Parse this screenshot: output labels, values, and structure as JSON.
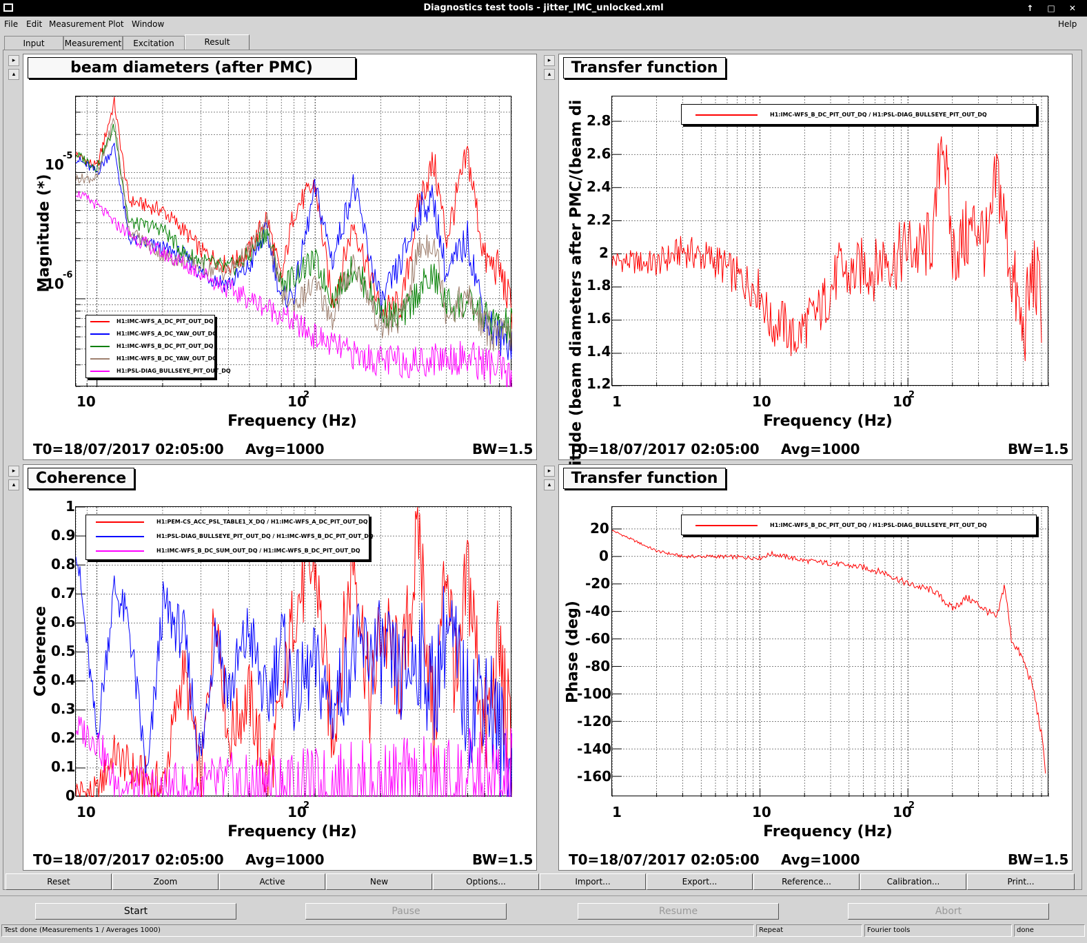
{
  "window": {
    "title": "Diagnostics test tools - jitter_IMC_unlocked.xml",
    "controls": "↑ □ ✕"
  },
  "menu": {
    "file": "File",
    "edit": "Edit",
    "measurement": "Measurement",
    "plot": "Plot",
    "window": "Window",
    "help": "Help"
  },
  "tabs": {
    "input": "Input",
    "measurement": "Measurement",
    "excitation": "Excitation",
    "result": "Result"
  },
  "panels": {
    "tl": {
      "title": "beam diameters (after PMC)",
      "ylabel": "Magnitude (*)",
      "xlabel": "Frequency (Hz)",
      "yticks": [
        "10",
        "-5",
        "10",
        "-6"
      ],
      "xticks": [
        "10",
        "10",
        "2"
      ],
      "footer": {
        "t0": "T0=18/07/2017 02:05:00",
        "avg": "Avg=1000",
        "bw": "BW=1.5"
      },
      "legend": [
        "H1:IMC-WFS_A_DC_PIT_OUT_DQ",
        "H1:IMC-WFS_A_DC_YAW_OUT_DQ",
        "H1:IMC-WFS_B_DC_PIT_OUT_DQ",
        "H1:IMC-WFS_B_DC_YAW_OUT_DQ",
        "H1:PSL-DIAG_BULLSEYE_PIT_OUT_DQ"
      ]
    },
    "tr": {
      "title": "Transfer function",
      "ylabel": "Magnitude (beam diameters after PMC/(beam di",
      "xlabel": "Frequency (Hz)",
      "yticks": [
        "2.8",
        "2.6",
        "2.4",
        "2.2",
        "2",
        "1.8",
        "1.6",
        "1.4",
        "1.2"
      ],
      "xticks": [
        "1",
        "10",
        "10",
        "2"
      ],
      "footer": {
        "t0": "T0=18/07/2017 02:05:00",
        "avg": "Avg=1000",
        "bw": "BW=1.5"
      },
      "legend": [
        "H1:IMC-WFS_B_DC_PIT_OUT_DQ / H1:PSL-DIAG_BULLSEYE_PIT_OUT_DQ"
      ]
    },
    "bl": {
      "title": "Coherence",
      "ylabel": "Coherence",
      "xlabel": "Frequency (Hz)",
      "yticks": [
        "1",
        "0.9",
        "0.8",
        "0.7",
        "0.6",
        "0.5",
        "0.4",
        "0.3",
        "0.2",
        "0.1",
        "0"
      ],
      "xticks": [
        "10",
        "10",
        "2"
      ],
      "footer": {
        "t0": "T0=18/07/2017 02:05:00",
        "avg": "Avg=1000",
        "bw": "BW=1.5"
      },
      "legend": [
        "H1:PEM-CS_ACC_PSL_TABLE1_X_DQ / H1:IMC-WFS_A_DC_PIT_OUT_DQ",
        "H1:PSL-DIAG_BULLSEYE_PIT_OUT_DQ / H1:IMC-WFS_B_DC_PIT_OUT_DQ",
        "H1:IMC-WFS_B_DC_SUM_OUT_DQ / H1:IMC-WFS_B_DC_PIT_OUT_DQ"
      ]
    },
    "br": {
      "title": "Transfer function",
      "ylabel": "Phase (deg)",
      "xlabel": "Frequency (Hz)",
      "yticks": [
        "20",
        "0",
        "-20",
        "-40",
        "-60",
        "-80",
        "-100",
        "-120",
        "-140",
        "-160"
      ],
      "xticks": [
        "1",
        "10",
        "10",
        "2"
      ],
      "footer": {
        "t0": "T0=18/07/2017 02:05:00",
        "avg": "Avg=1000",
        "bw": "BW=1.5"
      },
      "legend": [
        "H1:IMC-WFS_B_DC_PIT_OUT_DQ / H1:PSL-DIAG_BULLSEYE_PIT_OUT_DQ"
      ]
    }
  },
  "colors": {
    "red": "#ff0000",
    "blue": "#0000ff",
    "green": "#007f00",
    "brown": "#9e7f6e",
    "magenta": "#ff00ff"
  },
  "buttons": {
    "reset": "Reset",
    "zoom": "Zoom",
    "active": "Active",
    "new": "New",
    "options": "Options...",
    "import": "Import...",
    "export": "Export...",
    "reference": "Reference...",
    "calibration": "Calibration...",
    "print": "Print..."
  },
  "controls": {
    "start": "Start",
    "pause": "Pause",
    "resume": "Resume",
    "abort": "Abort"
  },
  "status": {
    "message": "Test done (Measurements 1 / Averages 1000)",
    "repeat": "Repeat",
    "fourier": "Fourier tools",
    "state": "done"
  },
  "chart_data": [
    {
      "type": "line",
      "title": "beam diameters (after PMC)",
      "xlabel": "Frequency (Hz)",
      "ylabel": "Magnitude (*)",
      "xscale": "log",
      "yscale": "log",
      "xlim": [
        8,
        800
      ],
      "ylim": [
        2e-07,
        4e-05
      ],
      "legend": "bottom-left",
      "grid": true,
      "series": [
        {
          "name": "H1:IMC-WFS_A_DC_PIT_OUT_DQ",
          "color": "#ff0000",
          "x": [
            8,
            10,
            12,
            14,
            20,
            25,
            30,
            40,
            50,
            60,
            70,
            80,
            100,
            120,
            150,
            200,
            250,
            300,
            350,
            400,
            500,
            600,
            700,
            800
          ],
          "y": [
            1.4e-05,
            1.1e-05,
            3.6e-05,
            6e-06,
            5e-06,
            3.5e-06,
            2.4e-06,
            1.8e-06,
            2.4e-06,
            4.5e-06,
            1.4e-06,
            5e-06,
            8e-06,
            9e-07,
            4e-06,
            8e-07,
            9e-07,
            6e-06,
            1.2e-05,
            3e-06,
            1.4e-05,
            2e-06,
            1.7e-06,
            8e-07
          ]
        },
        {
          "name": "H1:IMC-WFS_A_DC_YAW_OUT_DQ",
          "color": "#0000ff",
          "x": [
            8,
            10,
            12,
            14,
            20,
            25,
            30,
            40,
            50,
            60,
            70,
            80,
            100,
            120,
            150,
            200,
            250,
            300,
            350,
            400,
            500,
            600,
            700,
            800
          ],
          "y": [
            1.3e-05,
            1e-05,
            1.6e-05,
            3e-06,
            2.5e-06,
            2.2e-06,
            1.6e-06,
            1.3e-06,
            1.8e-06,
            3.5e-06,
            1e-06,
            1.1e-06,
            7.5e-06,
            2e-06,
            8e-06,
            9e-07,
            2e-06,
            5e-06,
            6e-06,
            1.5e-06,
            3e-06,
            7e-07,
            5e-07,
            4.5e-07
          ]
        },
        {
          "name": "H1:IMC-WFS_B_DC_PIT_OUT_DQ",
          "color": "#007f00",
          "x": [
            8,
            10,
            12,
            14,
            20,
            25,
            30,
            40,
            50,
            60,
            70,
            80,
            100,
            120,
            150,
            200,
            250,
            300,
            350,
            400,
            500,
            600,
            700,
            800
          ],
          "y": [
            1.4e-05,
            1.1e-05,
            2.3e-05,
            4e-06,
            3.6e-06,
            2.3e-06,
            2e-06,
            1.7e-06,
            2.2e-06,
            3.5e-06,
            1.3e-06,
            1.5e-06,
            2e-06,
            1e-06,
            1.8e-06,
            8e-07,
            7e-07,
            1.2e-06,
            1.5e-06,
            9e-07,
            9e-07,
            7e-07,
            6e-07,
            6e-07
          ]
        },
        {
          "name": "H1:IMC-WFS_B_DC_YAW_OUT_DQ",
          "color": "#9e7f6e",
          "x": [
            8,
            10,
            12,
            14,
            20,
            25,
            30,
            40,
            50,
            60,
            70,
            80,
            100,
            120,
            150,
            200,
            250,
            300,
            350,
            400,
            500,
            600,
            700,
            800
          ],
          "y": [
            9e-06,
            9e-06,
            2.7e-05,
            3.5e-06,
            2.2e-06,
            2e-06,
            1.8e-06,
            1.6e-06,
            2.4e-06,
            4e-06,
            1.1e-06,
            9e-07,
            1.3e-06,
            7e-07,
            2e-06,
            6e-07,
            7e-07,
            2.5e-06,
            3e-06,
            8e-07,
            1e-06,
            6e-07,
            5e-07,
            5e-07
          ]
        },
        {
          "name": "H1:PSL-DIAG_BULLSEYE_PIT_OUT_DQ",
          "color": "#ff00ff",
          "x": [
            8,
            10,
            12,
            15,
            20,
            30,
            40,
            50,
            70,
            100,
            150,
            200,
            300,
            400,
            500,
            600,
            700,
            800
          ],
          "y": [
            7e-06,
            5.5e-06,
            4e-06,
            3e-06,
            2.3e-06,
            1.6e-06,
            1.2e-06,
            1e-06,
            7.5e-07,
            5e-07,
            3.6e-07,
            3.2e-07,
            3.2e-07,
            3.5e-07,
            3.4e-07,
            3.1e-07,
            2.7e-07,
            2.1e-07
          ]
        }
      ]
    },
    {
      "type": "line",
      "title": "Transfer function",
      "xlabel": "Frequency (Hz)",
      "ylabel": "Magnitude (beam diameters after PMC/(beam di",
      "xscale": "log",
      "xlim": [
        1,
        900
      ],
      "ylim": [
        1.2,
        2.95
      ],
      "legend": "top-right",
      "grid": true,
      "series": [
        {
          "name": "H1:IMC-WFS_B_DC_PIT_OUT_DQ / H1:PSL-DIAG_BULLSEYE_PIT_OUT_DQ",
          "color": "#ff0000",
          "x": [
            1,
            2,
            3,
            5,
            7,
            10,
            12,
            14,
            17,
            20,
            25,
            30,
            35,
            40,
            50,
            60,
            70,
            80,
            100,
            120,
            150,
            170,
            200,
            250,
            300,
            350,
            400,
            500,
            600,
            700,
            800
          ],
          "y": [
            1.96,
            1.94,
            2.02,
            1.96,
            1.86,
            1.78,
            1.55,
            1.6,
            1.47,
            1.57,
            1.65,
            1.78,
            1.92,
            1.85,
            1.93,
            1.9,
            2.0,
            1.95,
            2.05,
            2.0,
            2.1,
            2.8,
            2.0,
            2.1,
            2.2,
            2.0,
            2.5,
            1.9,
            1.5,
            1.9,
            1.7
          ]
        }
      ]
    },
    {
      "type": "line",
      "title": "Coherence",
      "xlabel": "Frequency (Hz)",
      "ylabel": "Coherence",
      "xscale": "log",
      "xlim": [
        8,
        800
      ],
      "ylim": [
        0,
        1
      ],
      "legend": "top",
      "grid": true,
      "series": [
        {
          "name": "H1:PEM-CS_ACC_PSL_TABLE1_X_DQ / H1:IMC-WFS_A_DC_PIT_OUT_DQ",
          "color": "#ff0000",
          "x": [
            8,
            10,
            12,
            15,
            20,
            25,
            30,
            35,
            40,
            50,
            60,
            70,
            80,
            100,
            120,
            150,
            180,
            200,
            250,
            300,
            350,
            400,
            450,
            500,
            600,
            700,
            800
          ],
          "y": [
            0.02,
            0.01,
            0.15,
            0.08,
            0.03,
            0.45,
            0.05,
            0.68,
            0.2,
            0.35,
            0.05,
            0.3,
            0.65,
            0.8,
            0.2,
            0.85,
            0.3,
            0.6,
            0.4,
            0.93,
            0.2,
            0.85,
            0.3,
            0.8,
            0.2,
            0.5,
            0.1
          ]
        },
        {
          "name": "H1:PSL-DIAG_BULLSEYE_PIT_OUT_DQ / H1:IMC-WFS_B_DC_PIT_OUT_DQ",
          "color": "#0000ff",
          "x": [
            8,
            10,
            12,
            14,
            17,
            20,
            25,
            30,
            35,
            40,
            50,
            60,
            70,
            80,
            100,
            120,
            150,
            200,
            250,
            300,
            350,
            400,
            500,
            600,
            700,
            800
          ],
          "y": [
            0.88,
            0.2,
            0.72,
            0.6,
            0.05,
            0.66,
            0.55,
            0.12,
            0.6,
            0.35,
            0.58,
            0.3,
            0.55,
            0.35,
            0.45,
            0.3,
            0.5,
            0.5,
            0.4,
            0.5,
            0.35,
            0.6,
            0.3,
            0.4,
            0.2,
            0.1
          ]
        },
        {
          "name": "H1:IMC-WFS_B_DC_SUM_OUT_DQ / H1:IMC-WFS_B_DC_PIT_OUT_DQ",
          "color": "#ff00ff",
          "x": [
            8,
            10,
            12,
            15,
            20,
            30,
            40,
            50,
            60,
            70,
            100,
            150,
            200,
            300,
            400,
            500,
            600,
            700,
            800
          ],
          "y": [
            0.24,
            0.2,
            0.05,
            0.03,
            0.02,
            0.03,
            0.04,
            0.02,
            0.05,
            0.02,
            0.02,
            0.03,
            0.02,
            0.02,
            0.02,
            0.03,
            0.02,
            0.02,
            0.02
          ]
        }
      ]
    },
    {
      "type": "line",
      "title": "Transfer function",
      "xlabel": "Frequency (Hz)",
      "ylabel": "Phase (deg)",
      "xscale": "log",
      "xlim": [
        1,
        900
      ],
      "ylim": [
        -175,
        36
      ],
      "legend": "top-right",
      "grid": true,
      "series": [
        {
          "name": "H1:IMC-WFS_B_DC_PIT_OUT_DQ / H1:PSL-DIAG_BULLSEYE_PIT_OUT_DQ",
          "color": "#ff0000",
          "x": [
            1,
            2,
            3,
            5,
            10,
            12,
            20,
            30,
            50,
            70,
            100,
            150,
            200,
            250,
            300,
            400,
            450,
            500,
            600,
            700,
            800,
            850
          ],
          "y": [
            19,
            4,
            0,
            0,
            -1,
            2,
            -3,
            -5,
            -8,
            -12,
            -20,
            -25,
            -38,
            -30,
            -35,
            -45,
            -20,
            -60,
            -75,
            -95,
            -130,
            -155
          ]
        }
      ]
    }
  ]
}
